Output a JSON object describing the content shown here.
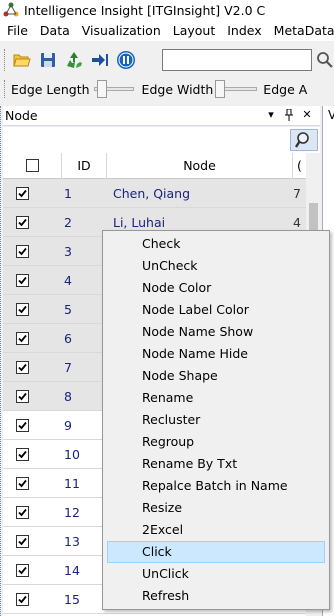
{
  "window": {
    "title": "Intelligence Insight [ITGInsight] V2.0 C"
  },
  "menubar": [
    "File",
    "Data",
    "Visualization",
    "Layout",
    "Index",
    "MetaData"
  ],
  "toolbar": {
    "icons": [
      "open-folder-icon",
      "save-disk-icon",
      "recycle-icon",
      "export-arrow-icon",
      "pause-icon"
    ],
    "search_value": ""
  },
  "toolbar2": {
    "edge_length_label": "Edge Length",
    "edge_width_label": "Edge Width",
    "edge_third_label": "Edge A"
  },
  "panel": {
    "title": "Node",
    "right_pane_label": "V"
  },
  "grid": {
    "columns": [
      "ID",
      "Node",
      "("
    ],
    "rows": [
      {
        "id": "1",
        "node": "Chen, Qiang",
        "extra": "7",
        "checked": true,
        "shaded": true
      },
      {
        "id": "2",
        "node": "Li, Luhai",
        "extra": "4",
        "checked": true,
        "shaded": true
      },
      {
        "id": "3",
        "node": "",
        "extra": "",
        "checked": true,
        "shaded": true
      },
      {
        "id": "4",
        "node": "",
        "extra": "",
        "checked": true,
        "shaded": true
      },
      {
        "id": "5",
        "node": "",
        "extra": "",
        "checked": true,
        "shaded": true
      },
      {
        "id": "6",
        "node": "",
        "extra": "",
        "checked": true,
        "shaded": true
      },
      {
        "id": "7",
        "node": "",
        "extra": "",
        "checked": true,
        "shaded": true
      },
      {
        "id": "8",
        "node": "",
        "extra": "",
        "checked": true,
        "shaded": true
      },
      {
        "id": "9",
        "node": "",
        "extra": "",
        "checked": true,
        "shaded": false
      },
      {
        "id": "10",
        "node": "",
        "extra": "",
        "checked": true,
        "shaded": false
      },
      {
        "id": "11",
        "node": "",
        "extra": "",
        "checked": true,
        "shaded": false
      },
      {
        "id": "12",
        "node": "",
        "extra": "",
        "checked": true,
        "shaded": false
      },
      {
        "id": "13",
        "node": "",
        "extra": "",
        "checked": true,
        "shaded": false
      },
      {
        "id": "14",
        "node": "",
        "extra": "",
        "checked": true,
        "shaded": false
      },
      {
        "id": "15",
        "node": "",
        "extra": "",
        "checked": true,
        "shaded": false
      }
    ]
  },
  "context_menu": {
    "items": [
      "Check",
      "UnCheck",
      "Node Color",
      "Node Label Color",
      "Node Name Show",
      "Node Name Hide",
      "Node Shape",
      "Rename",
      "Recluster",
      "Regroup",
      "Rename By Txt",
      "Repalce Batch in Name",
      "Resize",
      "2Excel",
      "Click",
      "UnClick",
      "Refresh"
    ],
    "highlighted": "Click"
  }
}
